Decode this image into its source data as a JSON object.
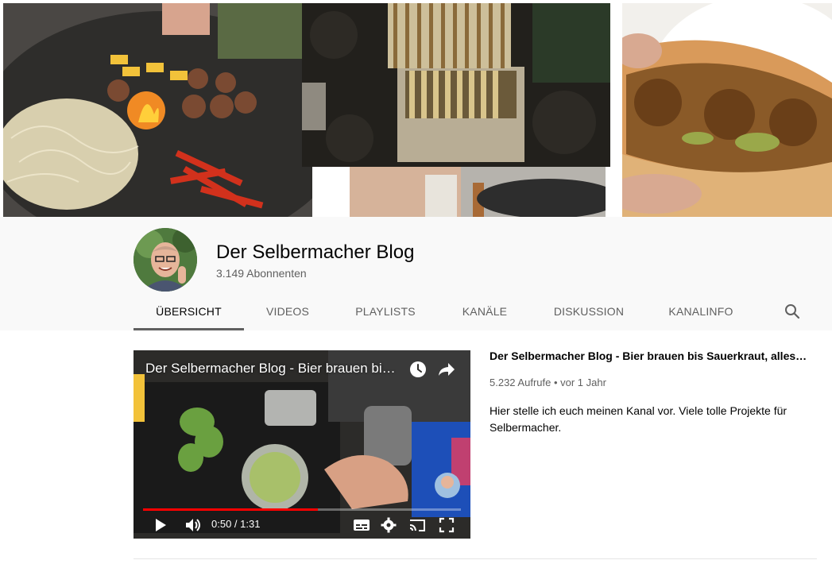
{
  "channel": {
    "name": "Der Selbermacher Blog",
    "subscribers": "3.149 Abonnenten"
  },
  "tabs": [
    {
      "label": "ÜBERSICHT",
      "active": true
    },
    {
      "label": "VIDEOS"
    },
    {
      "label": "PLAYLISTS"
    },
    {
      "label": "KANÄLE"
    },
    {
      "label": "DISKUSSION"
    },
    {
      "label": "KANALINFO"
    }
  ],
  "player": {
    "title": "Der Selbermacher Blog - Bier brauen bis Sauerkraut, alles selbst gemacht",
    "time": "0:50 / 1:31",
    "progress": 0.55
  },
  "video": {
    "title": "Der Selbermacher Blog - Bier brauen bis Sauerkraut, alles selbst gemacht",
    "views": "5.232 Aufrufe",
    "age": "vor 1 Jahr",
    "description": "Hier stelle ich euch meinen Kanal vor. Viele tolle Projekte für Selbermacher."
  },
  "colors": {
    "progress": "#ff0000",
    "header_bg": "#f9f9f9",
    "tab_active": "#030303",
    "tab_inactive": "#606060"
  },
  "icons": [
    "search-icon",
    "watch-later-icon",
    "share-icon",
    "play-icon",
    "volume-icon",
    "subtitles-icon",
    "settings-icon",
    "cast-icon",
    "fullscreen-icon"
  ]
}
